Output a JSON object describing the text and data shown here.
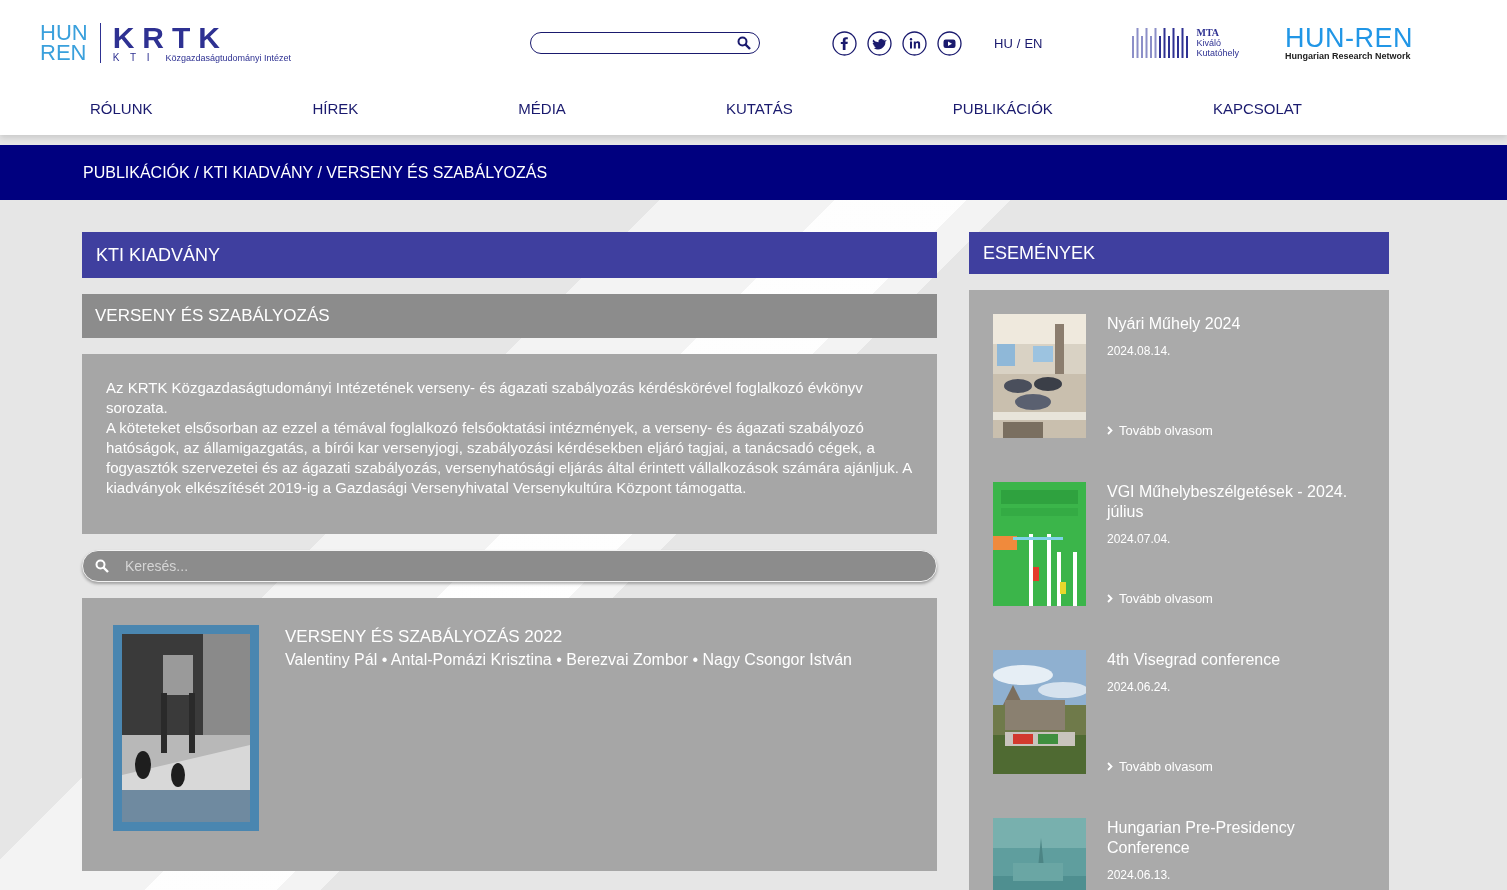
{
  "header": {
    "logo": {
      "top": "HUN",
      "bottom": "REN",
      "mark": "KRTK",
      "sub": "K T I",
      "institute": "Közgazdaságtudományi Intézet"
    },
    "languages": [
      "HU",
      "/",
      "EN"
    ],
    "mta_logo": {
      "title": "MTA",
      "line1": "Kiváló",
      "line2": "Kutatóhely"
    },
    "hunren_logo": {
      "title": "HUN-REN",
      "subtitle": "Hungarian Research Network"
    }
  },
  "nav": [
    {
      "label": "RÓLUNK"
    },
    {
      "label": "HÍREK"
    },
    {
      "label": "MÉDIA"
    },
    {
      "label": "KUTATÁS"
    },
    {
      "label": "PUBLIKÁCIÓK"
    },
    {
      "label": "KAPCSOLAT"
    }
  ],
  "breadcrumb": "PUBLIKÁCIÓK / KTI KIADVÁNY / VERSENY ÉS SZABÁLYOZÁS",
  "main": {
    "heading": "KTI KIADVÁNY",
    "subheading": "VERSENY ÉS SZABÁLYOZÁS",
    "description": [
      "Az KRTK Közgazdaságtudományi Intézetének verseny- és ágazati szabályozás kérdéskörével foglalkozó évkönyv sorozata.",
      "A köteteket elsősorban az ezzel a témával foglalkozó felsőoktatási intézmények, a verseny- és ágazati szabályozó hatóságok, az államigazgatás, a bírói kar versenyjogi, szabályozási kérdésekben eljáró tagjai, a tanácsadó cégek, a fogyasztók szervezetei és az ágazati szabályozás, versenyhatósági eljárás által érintett vállalkozások számára ajánljuk. A kiadványok elkészítését 2019-ig a Gazdasági Versenyhivatal Versenykultúra Központ támogatta."
    ],
    "search": {
      "placeholder": "Keresés..."
    },
    "publications": [
      {
        "title": "VERSENY ÉS SZABÁLYOZÁS 2022",
        "authors": "Valentiny Pál • Antal-Pomázi Krisztina • Berezvai Zombor • Nagy Csongor István"
      }
    ]
  },
  "events": {
    "heading": "ESEMÉNYEK",
    "items": [
      {
        "title": "Nyári Műhely 2024",
        "date": "2024.08.14.",
        "more": "Tovább olvasom"
      },
      {
        "title": "VGI Műhelybeszélgetések - 2024. július",
        "date": "2024.07.04.",
        "more": "Tovább olvasom"
      },
      {
        "title": "4th Visegrad conference",
        "date": "2024.06.24.",
        "more": "Tovább olvasom"
      },
      {
        "title": "Hungarian Pre-Presidency Conference",
        "date": "2024.06.13."
      }
    ]
  }
}
